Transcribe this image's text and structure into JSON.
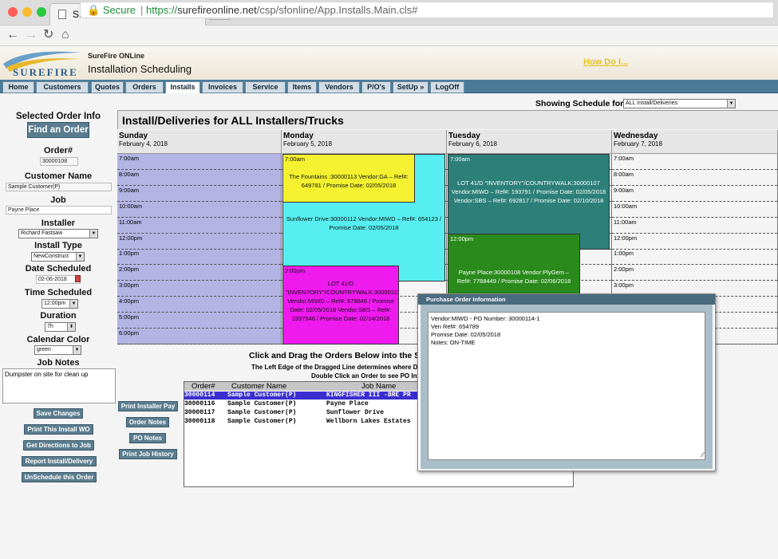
{
  "browser": {
    "tab_title": "SFONLine",
    "secure_label": "Secure",
    "url_prefix": "https://",
    "url_host": "surefireonline.net",
    "url_path": "/csp/sfonline/App.Installs.Main.cls#"
  },
  "app": {
    "logo_text": "SUREFIRE",
    "brand_small": "SureFire ONLine",
    "page_heading": "Installation Scheduling",
    "help_link": "How Do I..."
  },
  "nav_tabs": [
    "Home",
    "Customers",
    "Quotes",
    "Orders",
    "Installs",
    "Invoices",
    "Service",
    "Items",
    "Vendors",
    "P/O's",
    "SetUp »",
    "LogOff"
  ],
  "left_panel": {
    "selected_order_label": "Selected Order Info",
    "find_order_button": "Find an Order",
    "order_label": "Order#",
    "order_value": "30000108",
    "customer_label": "Customer Name",
    "customer_value": "Sample Customer(P)",
    "job_label": "Job",
    "job_value": "Payne Place",
    "installer_label": "Installer",
    "installer_value": "Richard Fastsaw",
    "install_type_label": "Install Type",
    "install_type_value": "NewConstruct",
    "date_label": "Date Scheduled",
    "date_value": "02-06-2018",
    "time_label": "Time Scheduled",
    "time_value": "12:00pm",
    "duration_label": "Duration",
    "duration_value": "7h",
    "color_label": "Calendar Color",
    "color_value": "green",
    "notes_label": "Job Notes",
    "notes_value": "Dumpster on site for clean up",
    "buttons": [
      "Save Changes",
      "Print This Install WO",
      "Get Directions to Job",
      "Report Install/Delivery",
      "UnSchedule this Order"
    ]
  },
  "schedule": {
    "showing_label": "Showing Schedule for:",
    "showing_value": "ALL Install/Deliveries",
    "title": "Install/Deliveries for ALL Installers/Trucks",
    "days": [
      {
        "name": "Sunday",
        "date": "February 4, 2018"
      },
      {
        "name": "Monday",
        "date": "February 5, 2018"
      },
      {
        "name": "Tuesday",
        "date": "February 6, 2018"
      },
      {
        "name": "Wednesday",
        "date": "February 7, 2018"
      }
    ],
    "hours": [
      "7:00am",
      "8:00am",
      "9:00am",
      "10:00am",
      "11:00am",
      "12:00pm",
      "1:00pm",
      "2:00pm",
      "3:00pm",
      "4:00pm",
      "5:00pm",
      "6:00pm"
    ],
    "events": {
      "mon_fountains": {
        "time": "7:00am",
        "text": "The Fountains :30000113 Vendor:GA – Ref#: 649781 / Promise Date: 02/05/2018",
        "color": "#f4f230"
      },
      "mon_sunflower": {
        "text": "Sunflower Drive:30000112 Vendor:MIWD – Ref#: 654123 / Promise Date: 02/05/2018",
        "color": "#56eef0"
      },
      "mon_lot41": {
        "time": "2:00pm",
        "text": "LOT 41/D \"INVENTORY\"/COUNTRYWALK:30000111 Vendor:MIWD – Ref#: 679846 / Promise Date: 02/05/2018 Vendor:SBS – Ref#: 1937546 / Promise Date: 02/14/2018",
        "color": "#ee1aee"
      },
      "tue_lot41": {
        "time": "7:00am",
        "text": "LOT 41/D \"INVENTORY\"/COUNTRYWALK:30000107 Vendor:MIWD – Ref#: 193791 / Promise Date: 02/05/2018 Vendor:SBS – Ref#: 692817 / Promise Date: 02/10/2018",
        "color": "#2d7f7a"
      },
      "tue_payne": {
        "time": "12:00pm",
        "text": "Payne Place:30000108 Vendor:PlyGem – Ref#: 7788449 / Promise Date: 02/06/2018",
        "color": "#2a8a1c"
      }
    }
  },
  "orders_list": {
    "title": "Click and Drag the Orders Below into the Sch",
    "subtitle1": "The Left Edge of the Dragged Line determines where D",
    "subtitle2": "Double Click an Order to see PO Inf",
    "col_order": "Order#",
    "col_customer": "Customer Name",
    "col_job": "Job Name",
    "rows": [
      {
        "order": "30000114",
        "customer": "Sample Customer(P)",
        "job": "KINGFISHER III -BRE PR"
      },
      {
        "order": "30000116",
        "customer": "Sample Customer(P)",
        "job": "Payne Place"
      },
      {
        "order": "30000117",
        "customer": "Sample Customer(P)",
        "job": "Sunflower Drive"
      },
      {
        "order": "30000118",
        "customer": "Sample Customer(P)",
        "job": "Wellborn Lakes Estates"
      }
    ],
    "buttons": [
      "Print Installer Pay",
      "Order Notes",
      "PO Notes",
      "Print Job History"
    ]
  },
  "popup": {
    "title": "Purchase Order Information",
    "line1": "Vendor:MIWD - PO Number: 30000114-1",
    "line2": "Ven Ref#: 654789",
    "line3": "Promise Date: 02/05/2018",
    "line4": "Notes: ON-TIME"
  }
}
